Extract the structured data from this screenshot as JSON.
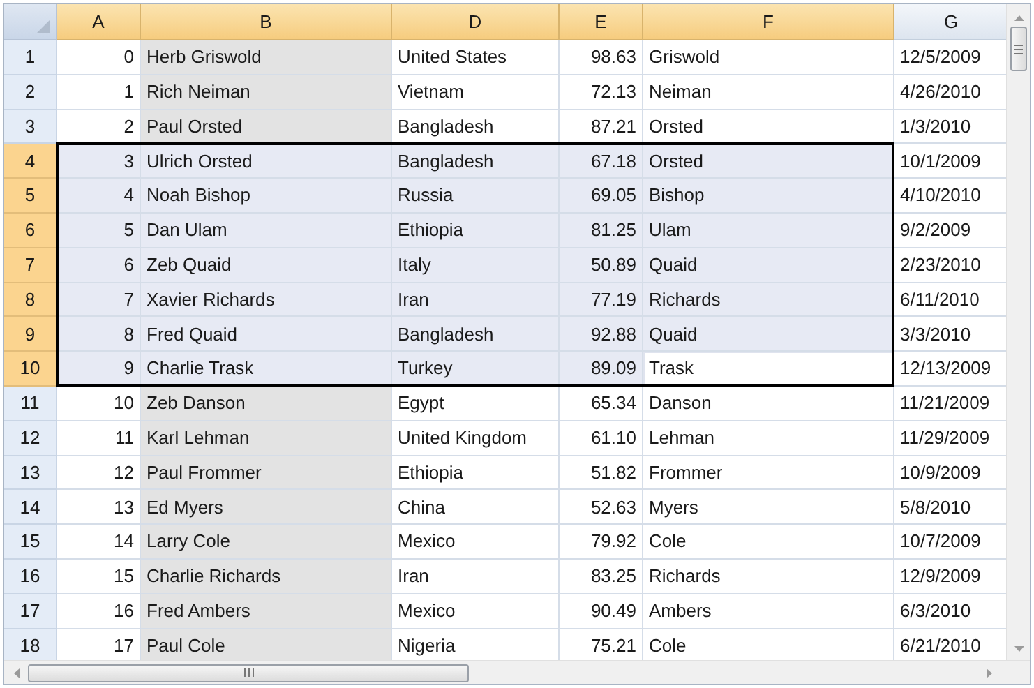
{
  "columns": [
    {
      "label": "A",
      "selected": true,
      "highlighted": false
    },
    {
      "label": "B",
      "selected": true,
      "highlighted": true
    },
    {
      "label": "D",
      "selected": true,
      "highlighted": false
    },
    {
      "label": "E",
      "selected": true,
      "highlighted": false
    },
    {
      "label": "F",
      "selected": true,
      "highlighted": false
    },
    {
      "label": "G",
      "selected": false,
      "highlighted": false
    }
  ],
  "rows": [
    {
      "header": "1",
      "selected": false,
      "active": false,
      "cells": [
        "0",
        "Herb Griswold",
        "United States",
        "98.63",
        "Griswold",
        "12/5/2009"
      ]
    },
    {
      "header": "2",
      "selected": false,
      "active": false,
      "cells": [
        "1",
        "Rich Neiman",
        "Vietnam",
        "72.13",
        "Neiman",
        "4/26/2010"
      ]
    },
    {
      "header": "3",
      "selected": false,
      "active": false,
      "cells": [
        "2",
        "Paul Orsted",
        "Bangladesh",
        "87.21",
        "Orsted",
        "1/3/2010"
      ]
    },
    {
      "header": "4",
      "selected": true,
      "active": false,
      "cells": [
        "3",
        "Ulrich Orsted",
        "Bangladesh",
        "67.18",
        "Orsted",
        "10/1/2009"
      ]
    },
    {
      "header": "5",
      "selected": true,
      "active": false,
      "cells": [
        "4",
        "Noah Bishop",
        "Russia",
        "69.05",
        "Bishop",
        "4/10/2010"
      ]
    },
    {
      "header": "6",
      "selected": true,
      "active": false,
      "cells": [
        "5",
        "Dan Ulam",
        "Ethiopia",
        "81.25",
        "Ulam",
        "9/2/2009"
      ]
    },
    {
      "header": "7",
      "selected": true,
      "active": false,
      "cells": [
        "6",
        "Zeb Quaid",
        "Italy",
        "50.89",
        "Quaid",
        "2/23/2010"
      ]
    },
    {
      "header": "8",
      "selected": true,
      "active": false,
      "cells": [
        "7",
        "Xavier Richards",
        "Iran",
        "77.19",
        "Richards",
        "6/11/2010"
      ]
    },
    {
      "header": "9",
      "selected": true,
      "active": false,
      "cells": [
        "8",
        "Fred Quaid",
        "Bangladesh",
        "92.88",
        "Quaid",
        "3/3/2010"
      ]
    },
    {
      "header": "10",
      "selected": true,
      "active": true,
      "cells": [
        "9",
        "Charlie Trask",
        "Turkey",
        "89.09",
        "Trask",
        "12/13/2009"
      ]
    },
    {
      "header": "11",
      "selected": false,
      "active": false,
      "cells": [
        "10",
        "Zeb Danson",
        "Egypt",
        "65.34",
        "Danson",
        "11/21/2009"
      ]
    },
    {
      "header": "12",
      "selected": false,
      "active": false,
      "cells": [
        "11",
        "Karl Lehman",
        "United Kingdom",
        "61.10",
        "Lehman",
        "11/29/2009"
      ]
    },
    {
      "header": "13",
      "selected": false,
      "active": false,
      "cells": [
        "12",
        "Paul Frommer",
        "Ethiopia",
        "51.82",
        "Frommer",
        "10/9/2009"
      ]
    },
    {
      "header": "14",
      "selected": false,
      "active": false,
      "cells": [
        "13",
        "Ed Myers",
        "China",
        "52.63",
        "Myers",
        "5/8/2010"
      ]
    },
    {
      "header": "15",
      "selected": false,
      "active": false,
      "cells": [
        "14",
        "Larry Cole",
        "Mexico",
        "79.92",
        "Cole",
        "10/7/2009"
      ]
    },
    {
      "header": "16",
      "selected": false,
      "active": false,
      "cells": [
        "15",
        "Charlie Richards",
        "Iran",
        "83.25",
        "Richards",
        "12/9/2009"
      ]
    },
    {
      "header": "17",
      "selected": false,
      "active": false,
      "cells": [
        "16",
        "Fred Ambers",
        "Mexico",
        "90.49",
        "Ambers",
        "6/3/2010"
      ]
    },
    {
      "header": "18",
      "selected": false,
      "active": false,
      "cells": [
        "17",
        "Paul Cole",
        "Nigeria",
        "75.21",
        "Cole",
        "6/21/2010"
      ]
    }
  ]
}
